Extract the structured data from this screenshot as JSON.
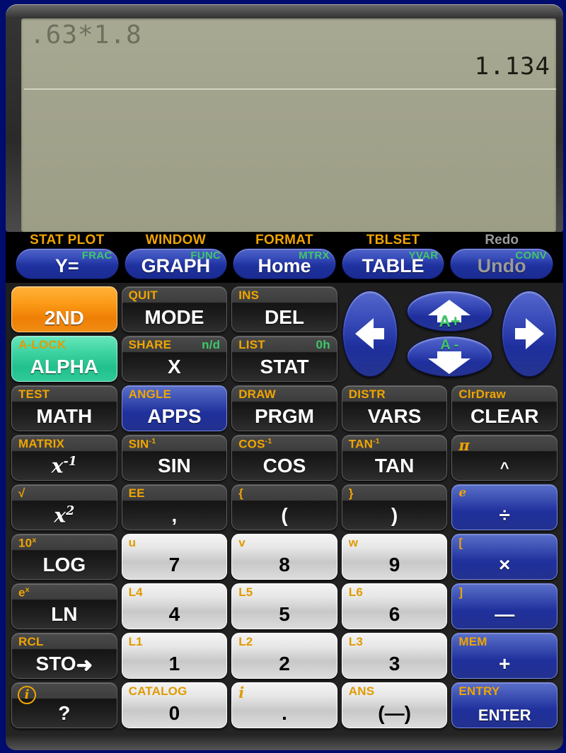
{
  "display": {
    "entry": ".63*1.8",
    "result": "1.134"
  },
  "colors": {
    "second": "#f0a500",
    "alpha": "#3ec86a",
    "blue_key": "#2431a0",
    "orange_key": "#f59100",
    "teal_key": "#2ecb99",
    "lcd": "#a2a38c",
    "frame": "#000b6e"
  },
  "top_row": [
    {
      "second": "STAT PLOT",
      "alpha": "FRAC",
      "main": "Y=",
      "disabled": false
    },
    {
      "second": "WINDOW",
      "alpha": "FUNC",
      "main": "GRAPH",
      "disabled": false
    },
    {
      "second": "FORMAT",
      "alpha": "MTRX",
      "main": "Home",
      "disabled": false
    },
    {
      "second": "TBLSET",
      "alpha": "YVAR",
      "main": "TABLE",
      "disabled": false
    },
    {
      "second": "Redo",
      "alpha": "CONV",
      "main": "Undo",
      "disabled": true
    }
  ],
  "dpad": {
    "left": "left-arrow",
    "right": "right-arrow",
    "up": {
      "glyph": "up-arrow",
      "label": "A+"
    },
    "down": {
      "glyph": "down-arrow",
      "label": "A -"
    }
  },
  "rows": [
    [
      {
        "name": "second",
        "second": "",
        "alpha": "",
        "main": "2ND",
        "style": "orange"
      },
      {
        "name": "mode",
        "second": "QUIT",
        "alpha": "",
        "main": "MODE",
        "style": "dark"
      },
      {
        "name": "del",
        "second": "INS",
        "alpha": "",
        "main": "DEL",
        "style": "dark"
      }
    ],
    [
      {
        "name": "alpha",
        "second": "A-LOCK",
        "alpha": "",
        "main": "ALPHA",
        "style": "teal"
      },
      {
        "name": "x-var",
        "second": "SHARE",
        "alpha": "n/d",
        "main": "X",
        "style": "dark"
      },
      {
        "name": "stat",
        "second": "LIST",
        "alpha": "0h",
        "main": "STAT",
        "style": "dark"
      }
    ],
    [
      {
        "name": "math",
        "second": "TEST",
        "alpha": "",
        "main": "MATH",
        "style": "dark"
      },
      {
        "name": "apps",
        "second": "ANGLE",
        "alpha": "",
        "main": "APPS",
        "style": "blue"
      },
      {
        "name": "prgm",
        "second": "DRAW",
        "alpha": "",
        "main": "PRGM",
        "style": "dark"
      },
      {
        "name": "vars",
        "second": "DISTR",
        "alpha": "",
        "main": "VARS",
        "style": "dark"
      },
      {
        "name": "clear",
        "second": "ClrDraw",
        "alpha": "",
        "main": "CLEAR",
        "style": "dark"
      }
    ],
    [
      {
        "name": "reciprocal",
        "second": "MATRIX",
        "alpha": "",
        "main": "x-1",
        "style": "dark"
      },
      {
        "name": "sin",
        "second": "SIN-1",
        "alpha": "",
        "main": "SIN",
        "style": "dark"
      },
      {
        "name": "cos",
        "second": "COS-1",
        "alpha": "",
        "main": "COS",
        "style": "dark"
      },
      {
        "name": "tan",
        "second": "TAN-1",
        "alpha": "",
        "main": "TAN",
        "style": "dark"
      },
      {
        "name": "power",
        "second": "π",
        "alpha": "",
        "main": "^",
        "style": "dark"
      }
    ],
    [
      {
        "name": "square",
        "second": "√",
        "alpha": "",
        "main": "x2",
        "style": "dark"
      },
      {
        "name": "comma",
        "second": "EE",
        "alpha": "",
        "main": ",",
        "style": "dark"
      },
      {
        "name": "open-paren",
        "second": "{",
        "alpha": "",
        "main": "(",
        "style": "dark"
      },
      {
        "name": "close-paren",
        "second": "}",
        "alpha": "",
        "main": ")",
        "style": "dark"
      },
      {
        "name": "divide",
        "second": "e",
        "alpha": "",
        "main": "÷",
        "style": "blue"
      }
    ],
    [
      {
        "name": "log",
        "second": "10x",
        "alpha": "",
        "main": "LOG",
        "style": "dark"
      },
      {
        "name": "seven",
        "second": "u",
        "alpha": "",
        "main": "7",
        "style": "num"
      },
      {
        "name": "eight",
        "second": "v",
        "alpha": "",
        "main": "8",
        "style": "num"
      },
      {
        "name": "nine",
        "second": "w",
        "alpha": "",
        "main": "9",
        "style": "num"
      },
      {
        "name": "multiply",
        "second": "[",
        "alpha": "",
        "main": "×",
        "style": "blue"
      }
    ],
    [
      {
        "name": "ln",
        "second": "ex",
        "alpha": "",
        "main": "LN",
        "style": "dark"
      },
      {
        "name": "four",
        "second": "L4",
        "alpha": "",
        "main": "4",
        "style": "num"
      },
      {
        "name": "five",
        "second": "L5",
        "alpha": "",
        "main": "5",
        "style": "num"
      },
      {
        "name": "six",
        "second": "L6",
        "alpha": "",
        "main": "6",
        "style": "num"
      },
      {
        "name": "subtract",
        "second": "]",
        "alpha": "",
        "main": "—",
        "style": "blue"
      }
    ],
    [
      {
        "name": "store",
        "second": "RCL",
        "alpha": "",
        "main": "STO",
        "style": "dark"
      },
      {
        "name": "one",
        "second": "L1",
        "alpha": "",
        "main": "1",
        "style": "num"
      },
      {
        "name": "two",
        "second": "L2",
        "alpha": "",
        "main": "2",
        "style": "num"
      },
      {
        "name": "three",
        "second": "L3",
        "alpha": "",
        "main": "3",
        "style": "num"
      },
      {
        "name": "add",
        "second": "MEM",
        "alpha": "",
        "main": "+",
        "style": "blue"
      }
    ],
    [
      {
        "name": "help",
        "second": "",
        "alpha": "",
        "main": "?",
        "style": "dark"
      },
      {
        "name": "zero",
        "second": "CATALOG",
        "alpha": "",
        "main": "0",
        "style": "num"
      },
      {
        "name": "decimal",
        "second": "i",
        "alpha": "",
        "main": ".",
        "style": "num"
      },
      {
        "name": "negate",
        "second": "ANS",
        "alpha": "",
        "main": "(—)",
        "style": "num"
      },
      {
        "name": "enter",
        "second": "ENTRY",
        "alpha": "",
        "main": "ENTER",
        "style": "blue"
      }
    ]
  ]
}
